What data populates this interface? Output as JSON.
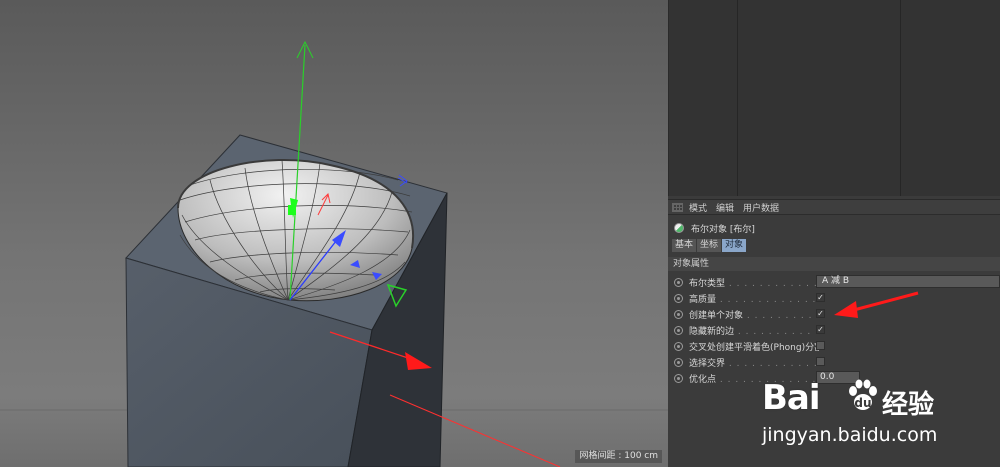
{
  "viewport": {
    "grid_readout": "网格间距 : 100 cm"
  },
  "attributes": {
    "toolbar": [
      "模式",
      "编辑",
      "用户数据"
    ],
    "object_title": "布尔对象 [布尔]",
    "tabs": [
      {
        "label": "基本",
        "active": false
      },
      {
        "label": "坐标",
        "active": false
      },
      {
        "label": "对象",
        "active": true
      }
    ],
    "section_header": "对象属性",
    "properties": [
      {
        "label": "布尔类型",
        "kind": "dropdown",
        "value": "A 减 B"
      },
      {
        "label": "高质量",
        "kind": "checkbox",
        "checked": true,
        "check_mark": "✓"
      },
      {
        "label": "创建单个对象",
        "kind": "checkbox",
        "checked": true,
        "check_mark": "✓"
      },
      {
        "label": "隐藏新的边",
        "kind": "checkbox",
        "checked": true,
        "check_mark": "✓"
      },
      {
        "label": "交叉处创建平滑着色(Phong)分割",
        "kind": "checkbox",
        "checked": false,
        "check_mark": ""
      },
      {
        "label": "选择交界",
        "kind": "checkbox",
        "checked": false,
        "check_mark": ""
      },
      {
        "label": "优化点",
        "kind": "number",
        "value": "0.0"
      }
    ]
  },
  "watermark": {
    "brand": "Bai",
    "brand_cn": "经验",
    "url": "jingyan.baidu.com"
  },
  "colors": {
    "axis_x": "#ff2a2a",
    "axis_y": "#22c02a",
    "axis_z": "#2a3cff",
    "annotation_arrow": "#ff1a1a",
    "active_tab": "#8aa6c9"
  }
}
